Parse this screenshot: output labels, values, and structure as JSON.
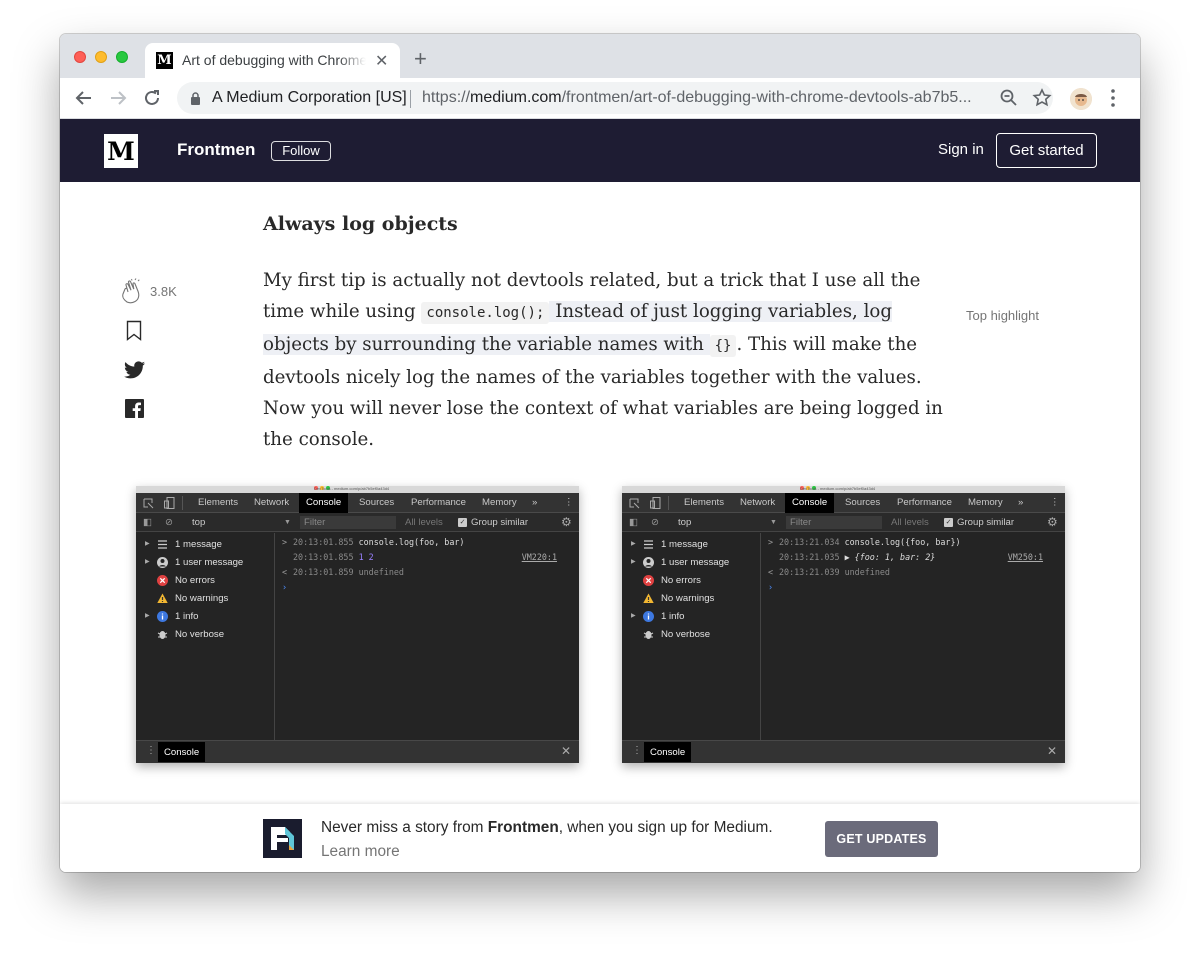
{
  "browser": {
    "tab_title": "Art of debugging with Chrome DevTools",
    "tab_icon": "medium-favicon-icon",
    "new_tab_label": "+",
    "org_name": "A Medium Corporation [US]",
    "url_domain": "medium.com",
    "url_prefix": "https://",
    "url_path": "/frontmen/art-of-debugging-with-chrome-devtools-ab7b5..."
  },
  "topbar": {
    "logo": "M",
    "publication": "Frontmen",
    "follow_label": "Follow",
    "signin_label": "Sign in",
    "getstarted_label": "Get started",
    "bg_color": "#1e1c33"
  },
  "article": {
    "heading": "Always log objects",
    "para_1": "My first tip is actually not devtools related, but a trick that I use all the time while using ",
    "code_1": "console.log();",
    "hl_1": " Instead of just logging variables, log objects by surrounding the variable names with ",
    "code_2": "{}",
    "para_2": ". This will make the devtools nicely log the names of the variables together with the values. Now you will never lose the context of what variables are being logged in the console.",
    "top_highlight": "Top highlight",
    "clap_count": "3.8K"
  },
  "devtools": [
    {
      "title": "DevTools - medium.com/p/ab7b5ef0a43d4",
      "tabs": [
        "Elements",
        "Network",
        "Console",
        "Sources",
        "Performance",
        "Memory"
      ],
      "more": "»",
      "context": "top",
      "filter_placeholder": "Filter",
      "levels": "All levels",
      "group_similar": "Group similar",
      "sidebar": [
        "1 message",
        "1 user message",
        "No errors",
        "No warnings",
        "1 info",
        "No verbose"
      ],
      "lines": [
        {
          "prefix": ">",
          "ts": "20:13:01.855",
          "text": "console.log(foo, bar)"
        },
        {
          "prefix": "",
          "ts": "20:13:01.855",
          "text": "1 2",
          "source": "VM220:1"
        },
        {
          "prefix": "<",
          "ts": "20:13:01.859",
          "text": "undefined"
        }
      ],
      "drawer_tab": "Console"
    },
    {
      "title": "DevTools - medium.com/p/ab7b5ef0a43d4",
      "tabs": [
        "Elements",
        "Network",
        "Console",
        "Sources",
        "Performance",
        "Memory"
      ],
      "more": "»",
      "context": "top",
      "filter_placeholder": "Filter",
      "levels": "All levels",
      "group_similar": "Group similar",
      "sidebar": [
        "1 message",
        "1 user message",
        "No errors",
        "No warnings",
        "1 info",
        "No verbose"
      ],
      "lines": [
        {
          "prefix": ">",
          "ts": "20:13:21.034",
          "text": "console.log({foo, bar})"
        },
        {
          "prefix": "",
          "ts": "20:13:21.035",
          "text": "▶ {foo: 1, bar: 2}",
          "source": "VM250:1"
        },
        {
          "prefix": "<",
          "ts": "20:13:21.039",
          "text": "undefined"
        }
      ],
      "drawer_tab": "Console"
    }
  ],
  "banner": {
    "text_before": "Never miss a story from ",
    "publication": "Frontmen",
    "text_after": ", when you sign up for Medium.",
    "learn_more": "Learn more",
    "button": "GET UPDATES"
  }
}
